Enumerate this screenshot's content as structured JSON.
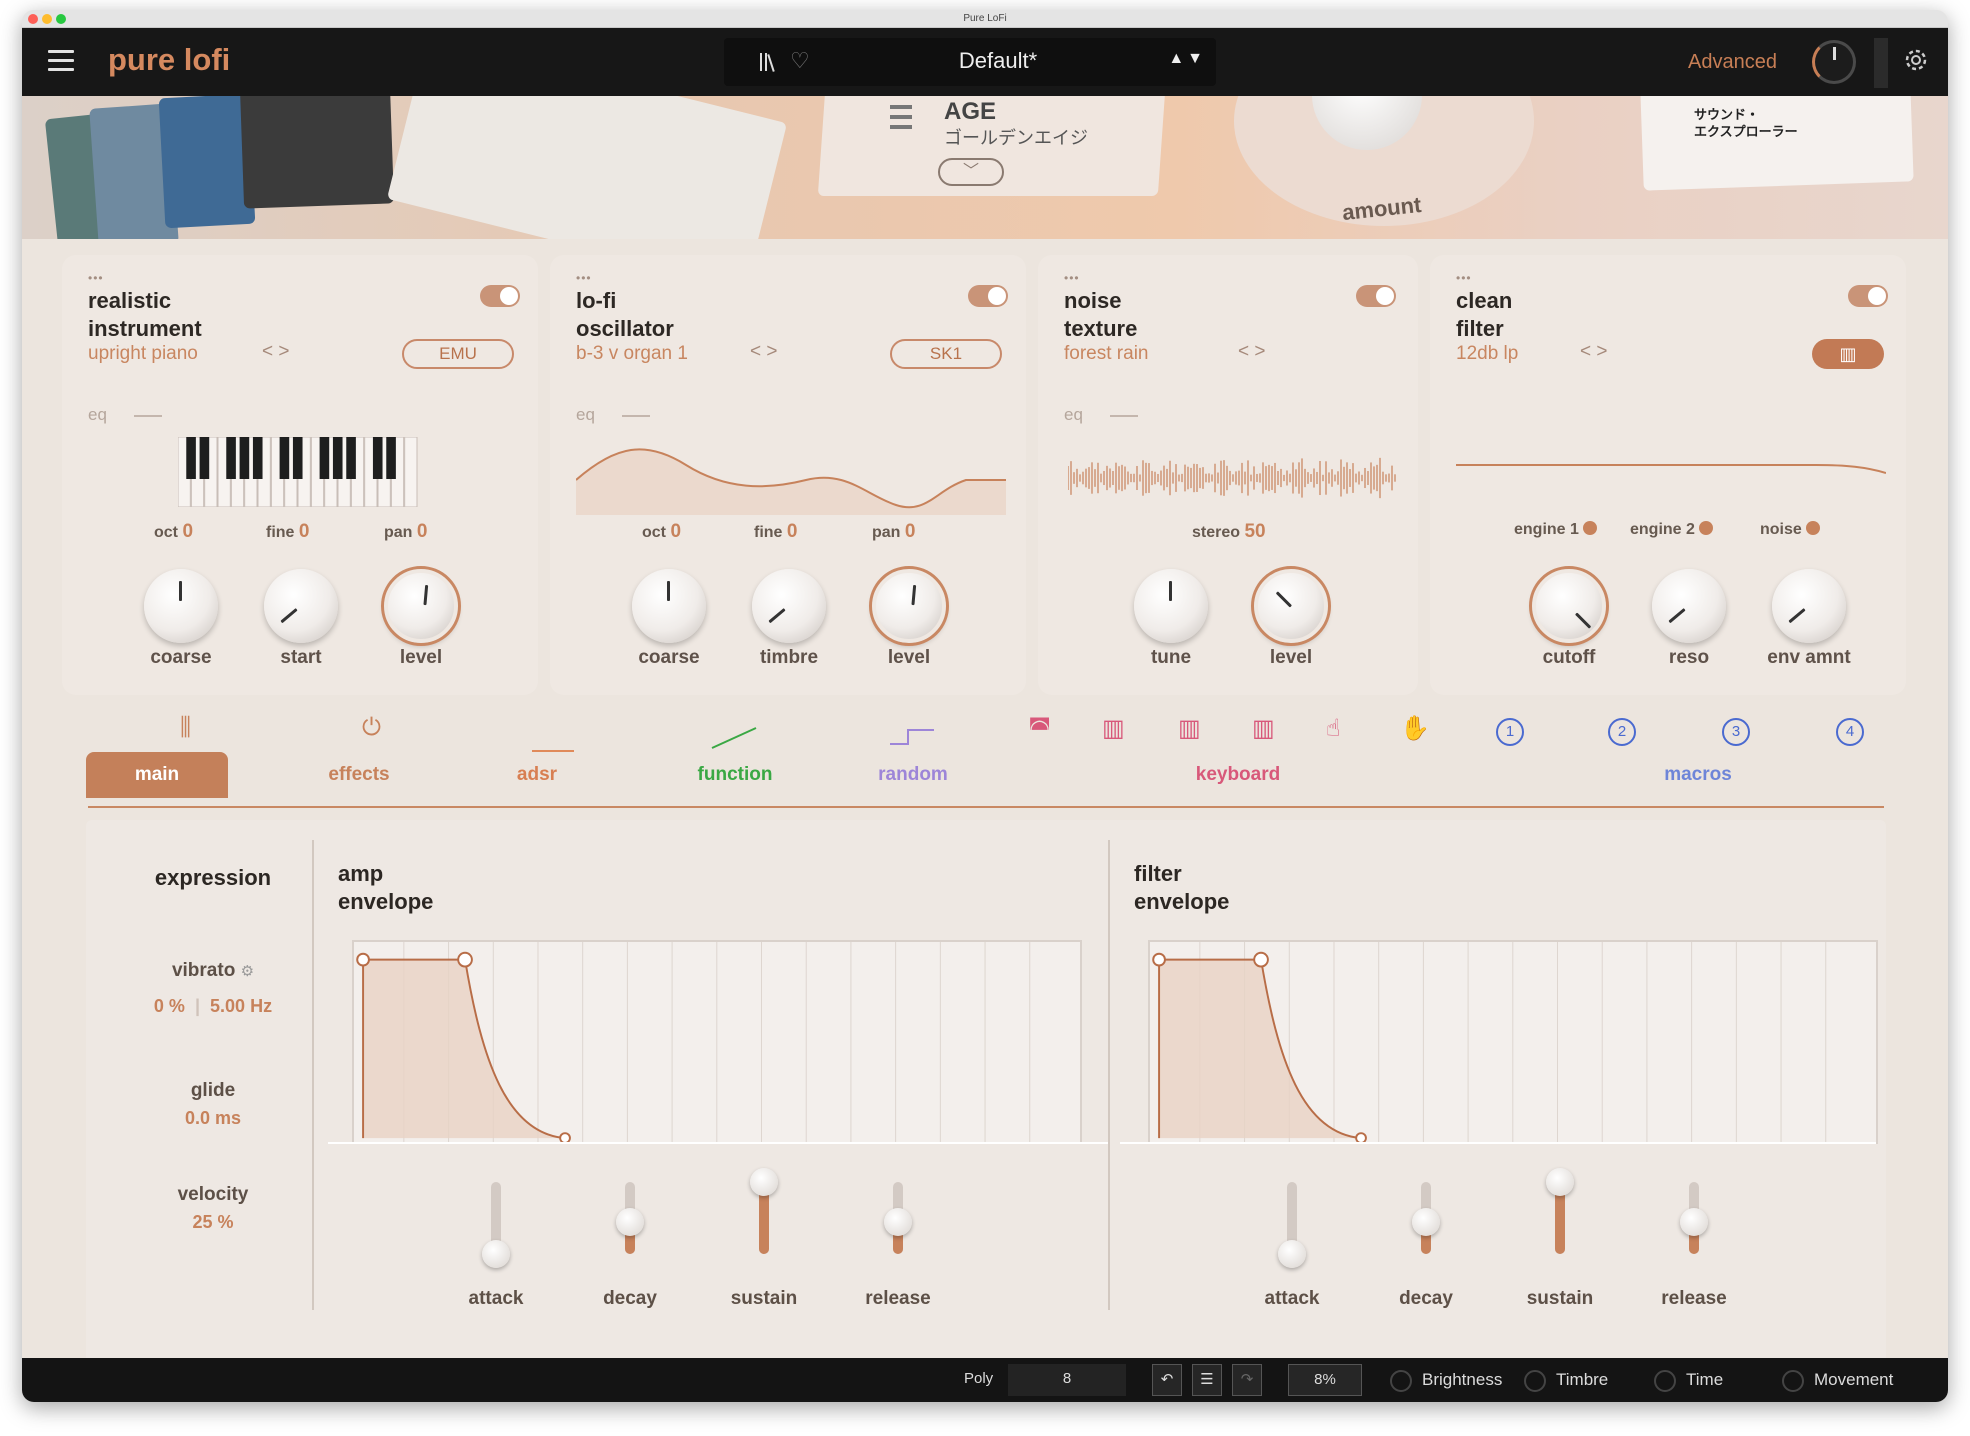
{
  "window": {
    "title": "Pure LoFi"
  },
  "header": {
    "app_title": "pure lofi",
    "preset_name": "Default*",
    "preset_arrows": "▲▼",
    "advanced_label": "Advanced"
  },
  "banner": {
    "age_title": "AGE",
    "age_jp": "ゴールデンエイジ",
    "sound_explorer": "サウンド・\nエクスプローラー",
    "amount_label": "amount"
  },
  "engines": [
    {
      "dots": "•••",
      "title": "realistic\ninstrument",
      "subtitle": "upright piano",
      "nav": "< >",
      "tag": "EMU",
      "params": [
        {
          "label": "oct",
          "value": "0"
        },
        {
          "label": "fine",
          "value": "0"
        },
        {
          "label": "pan",
          "value": "0"
        }
      ],
      "knobs": [
        "coarse",
        "start",
        "level"
      ]
    },
    {
      "dots": "•••",
      "title": "lo-fi\noscillator",
      "subtitle": "b-3 v organ 1",
      "nav": "< >",
      "tag": "SK1",
      "params": [
        {
          "label": "oct",
          "value": "0"
        },
        {
          "label": "fine",
          "value": "0"
        },
        {
          "label": "pan",
          "value": "0"
        }
      ],
      "knobs": [
        "coarse",
        "timbre",
        "level"
      ]
    },
    {
      "dots": "•••",
      "title": "noise\ntexture",
      "subtitle": "forest rain",
      "nav": "< >",
      "tag": "",
      "params": [
        {
          "label": "stereo",
          "value": "50"
        }
      ],
      "knobs": [
        "tune",
        "level"
      ]
    },
    {
      "dots": "•••",
      "title": "clean\nfilter",
      "subtitle": "12db lp",
      "nav": "< >",
      "tag": "",
      "params": [
        {
          "label": "engine 1",
          "value": ""
        },
        {
          "label": "engine 2",
          "value": ""
        },
        {
          "label": "noise",
          "value": ""
        }
      ],
      "knobs": [
        "cutoff",
        "reso",
        "env amnt"
      ]
    }
  ],
  "eq_label": "eq",
  "tabs": {
    "main": "main",
    "effects": "effects",
    "adsr": "adsr",
    "function": "function",
    "random": "random",
    "keyboard": "keyboard",
    "macros": "macros",
    "macro_numbers": [
      "1",
      "2",
      "3",
      "4"
    ]
  },
  "colors": {
    "accent": "#c7825b",
    "function": "#3aa844",
    "random": "#9d85d8",
    "keyboard": "#d8587a",
    "macros": "#4a6ad0"
  },
  "expression": {
    "title": "expression",
    "vibrato_label": "vibrato",
    "vibrato_amount": "0 %",
    "vibrato_rate": "5.00 Hz",
    "glide_label": "glide",
    "glide_value": "0.0 ms",
    "velocity_label": "velocity",
    "velocity_value": "25 %"
  },
  "amp_envelope": {
    "title": "amp\nenvelope",
    "sliders": [
      {
        "label": "attack",
        "value": 0.0
      },
      {
        "label": "decay",
        "value": 0.45
      },
      {
        "label": "sustain",
        "value": 1.0
      },
      {
        "label": "release",
        "value": 0.45
      }
    ]
  },
  "filter_envelope": {
    "title": "filter\nenvelope",
    "sliders": [
      {
        "label": "attack",
        "value": 0.0
      },
      {
        "label": "decay",
        "value": 0.45
      },
      {
        "label": "sustain",
        "value": 1.0
      },
      {
        "label": "release",
        "value": 0.45
      }
    ]
  },
  "footer": {
    "poly_label": "Poly",
    "poly_value": "8",
    "cpu_value": "8%",
    "macros": [
      "Brightness",
      "Timbre",
      "Time",
      "Movement"
    ]
  }
}
